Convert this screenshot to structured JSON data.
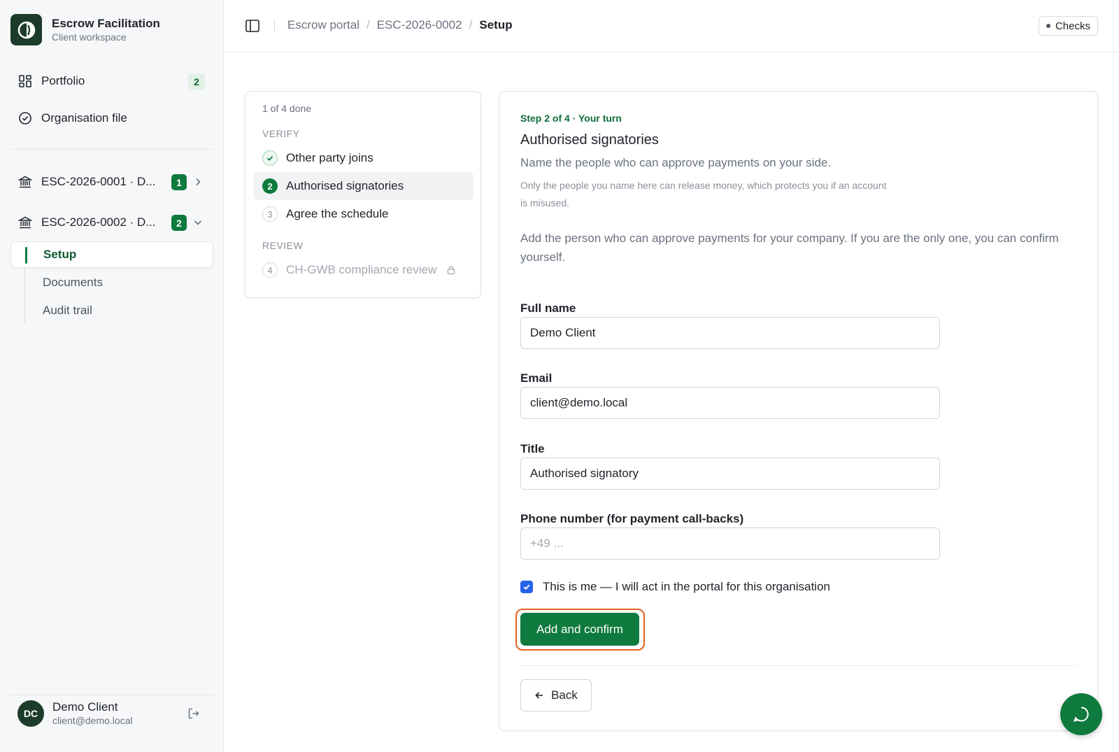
{
  "app": {
    "name": "Escrow Facilitation",
    "subtitle": "Client workspace"
  },
  "sidebar": {
    "portfolio": {
      "label": "Portfolio",
      "count": "2"
    },
    "org_file": {
      "label": "Organisation file"
    },
    "cases": [
      {
        "label": "ESC-2026-0001 · D...",
        "count": "1",
        "expanded": false
      },
      {
        "label": "ESC-2026-0002 · D...",
        "count": "2",
        "expanded": true
      }
    ],
    "case_nav": [
      {
        "label": "Setup",
        "active": true
      },
      {
        "label": "Documents",
        "active": false
      },
      {
        "label": "Audit trail",
        "active": false
      }
    ],
    "user": {
      "initials": "DC",
      "name": "Demo Client",
      "email": "client@demo.local"
    }
  },
  "header": {
    "breadcrumb": [
      "Escrow portal",
      "ESC-2026-0002",
      "Setup"
    ],
    "checks_label": "Checks"
  },
  "steps": {
    "progress": "1 of 4 done",
    "groups": [
      {
        "label": "VERIFY"
      },
      {
        "label": "REVIEW"
      }
    ],
    "items": [
      {
        "number": "1",
        "label": "Other party joins",
        "state": "done"
      },
      {
        "number": "2",
        "label": "Authorised signatories",
        "state": "active"
      },
      {
        "number": "3",
        "label": "Agree the schedule",
        "state": "todo"
      },
      {
        "number": "4",
        "label": "CH-GWB compliance review",
        "state": "locked"
      }
    ]
  },
  "form": {
    "eyebrow": "Step 2 of 4 · Your turn",
    "title": "Authorised signatories",
    "description": "Name the people who can approve payments on your side.",
    "note": "Only the people you name here can release money, which protects you if an account is misused.",
    "intro": "Add the person who can approve payments for your company. If you are the only one, you can confirm yourself.",
    "fields": [
      {
        "label": "Full name",
        "value": "Demo Client",
        "placeholder": ""
      },
      {
        "label": "Email",
        "value": "client@demo.local",
        "placeholder": ""
      },
      {
        "label": "Title",
        "value": "Authorised signatory",
        "placeholder": ""
      },
      {
        "label": "Phone number (for payment call-backs)",
        "value": "",
        "placeholder": "+49 ..."
      }
    ],
    "checkbox": {
      "label": "This is me — I will act in the portal for this organisation",
      "checked": true
    },
    "submit_label": "Add and confirm",
    "back_label": "Back"
  },
  "colors": {
    "brand_green": "#0f7a3d",
    "focus_ring": "#e2621b",
    "checkbox_blue": "#2563eb"
  },
  "icons": {
    "chat": "chat-bubble-icon"
  }
}
